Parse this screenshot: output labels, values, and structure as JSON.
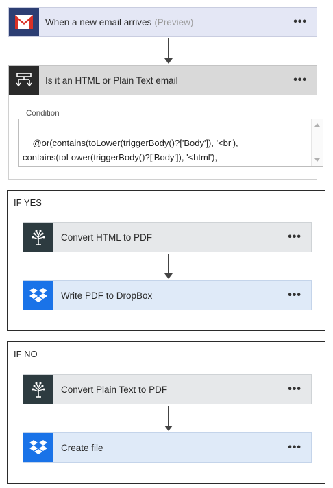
{
  "trigger": {
    "title": "When a new email arrives",
    "hint": "(Preview)",
    "menu": "•••",
    "icon": "gmail-icon",
    "color": "#e8eaf6"
  },
  "condition": {
    "title": "Is it an HTML or Plain Text email",
    "menu": "•••",
    "icon": "condition-icon",
    "field_label": "Condition",
    "expression": "@or(contains(toLower(triggerBody()?['Body']), '<br'),\ncontains(toLower(triggerBody()?['Body']), '<html'),\ncontains(toLower(triggerBody()?['Body']), '<p') )"
  },
  "if_yes": {
    "title": "IF YES",
    "actions": [
      {
        "label": "Convert HTML to PDF",
        "menu": "•••",
        "icon": "pdf-converter-icon"
      },
      {
        "label": "Write PDF to DropBox",
        "menu": "•••",
        "icon": "dropbox-icon"
      }
    ]
  },
  "if_no": {
    "title": "IF NO",
    "actions": [
      {
        "label": "Convert Plain Text to PDF",
        "menu": "•••",
        "icon": "pdf-converter-icon"
      },
      {
        "label": "Create file",
        "menu": "•••",
        "icon": "dropbox-icon"
      }
    ]
  },
  "colors": {
    "gmail_bg": "#2c3e73",
    "condition_bg": "#2a2a2a",
    "converter_bg": "#2d3b40",
    "dropbox_bg": "#1a73e8"
  }
}
